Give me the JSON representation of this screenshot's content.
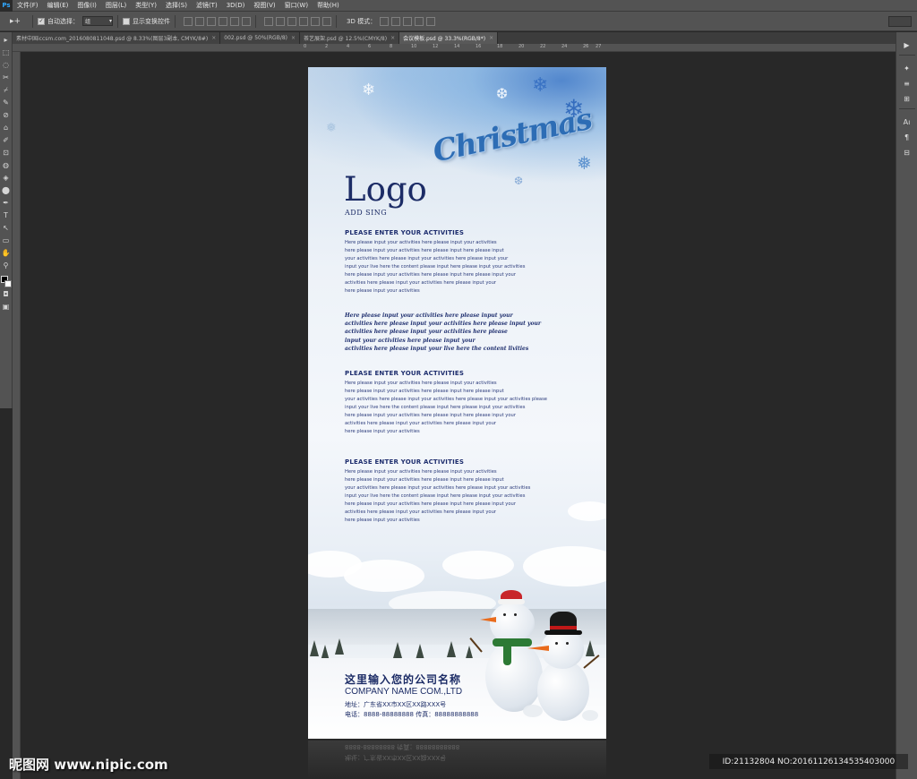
{
  "app": {
    "logo": "Ps"
  },
  "menu": [
    "文件(F)",
    "编辑(E)",
    "图像(I)",
    "图层(L)",
    "类型(Y)",
    "选择(S)",
    "滤镜(T)",
    "3D(D)",
    "视图(V)",
    "窗口(W)",
    "帮助(H)"
  ],
  "options": {
    "tool_glyph": "▸+",
    "auto_select_label": "自动选择：",
    "auto_select_value": "组",
    "show_transform_label": "显示变换控件",
    "mode_3d_label": "3D 模式："
  },
  "tabs": [
    {
      "label": "素材中国iccsm.com_2016080811048.psd @ 8.33%(图层3副本, CMYK/8#)",
      "active": false
    },
    {
      "label": "002.psd @ 50%(RGB/8)",
      "active": false
    },
    {
      "label": "茶艺展架.psd @ 12.5%(CMYK/8)",
      "active": false
    },
    {
      "label": "会议模板.psd @ 33.3%(RGB/8*)",
      "active": true
    }
  ],
  "ruler": [
    "0",
    "2",
    "4",
    "6",
    "8",
    "10",
    "12",
    "14",
    "16",
    "18",
    "20",
    "22",
    "24",
    "26",
    "27"
  ],
  "toolbox": [
    "▸",
    "⬚",
    "◌",
    "✂",
    "⌿",
    "✎",
    "⊘",
    "⌂",
    "✐",
    "⊡",
    "◍",
    "◈",
    "⬤",
    "✒",
    "T",
    "↖",
    "▭",
    "✋",
    "⚲"
  ],
  "dock": [
    "▶",
    "✦",
    "≡",
    "⊞",
    "Aı",
    "¶",
    "⊟"
  ],
  "poster": {
    "headline": "Christmas",
    "logo": "Logo",
    "logo_sub": "ADD SING",
    "sections": [
      {
        "title": "PLEASE ENTER YOUR ACTIVITIES",
        "lines": [
          "Here please input your activities here please input your activities",
          "here please input your activities here please input here please input",
          "your activities here please input your activities here please input your",
          "input your live here the content please input here please input your activities",
          "here please input your activities here please input here please input your",
          "activities here please input your activities here please input your",
          "here please input your activities"
        ]
      },
      {
        "title": "PLEASE ENTER YOUR ACTIVITIES",
        "lines": [
          "Here please input your activities here please input your activities",
          "here please input your activities here please input here please input",
          "your activities here please input your activities here please input your activities please",
          "input your live here the content please input here please input your activities",
          "here please input your activities here please input here please input your",
          "activities here please input your activities here please input your",
          "here please input your activities"
        ]
      },
      {
        "title": "PLEASE ENTER YOUR ACTIVITIES",
        "lines": [
          "Here please input your activities here please input your activities",
          "here please input your activities here please input here please input",
          "your activities here please input your activities here please input your activities",
          "input your live here the content please input here please input your activities",
          "here please input your activities here please input here please input your",
          "activities here please input your activities here please input your",
          "here please input your activities"
        ]
      }
    ],
    "italic_lines": [
      "Here please input your activities here please input your",
      "activities here please input your activities here please input your",
      "activities here please input your activities here please",
      "input your activities here please input your",
      "activities here please input your live here the content livities"
    ],
    "company_cn": "这里输入您的公司名称",
    "company_en": "COMPANY NAME COM.,LTD",
    "address": "地址：广东省XX市XX区XX路XXX号",
    "phone": "电话：8888-88888888 传真：88888888888",
    "reflection_line1": "8888-88888888 传真：88888888888",
    "reflection_line2": "地址：广东省XX市XX区XX路XXX号"
  },
  "watermark": {
    "left": "昵图网 www.nipic.com",
    "right": "ID:21132804 NO:20161126134535403000"
  },
  "colors": {
    "ui_bg": "#282828",
    "panel": "#535353",
    "navy": "#1c2c66",
    "christmas_blue": "#2d6db5"
  }
}
